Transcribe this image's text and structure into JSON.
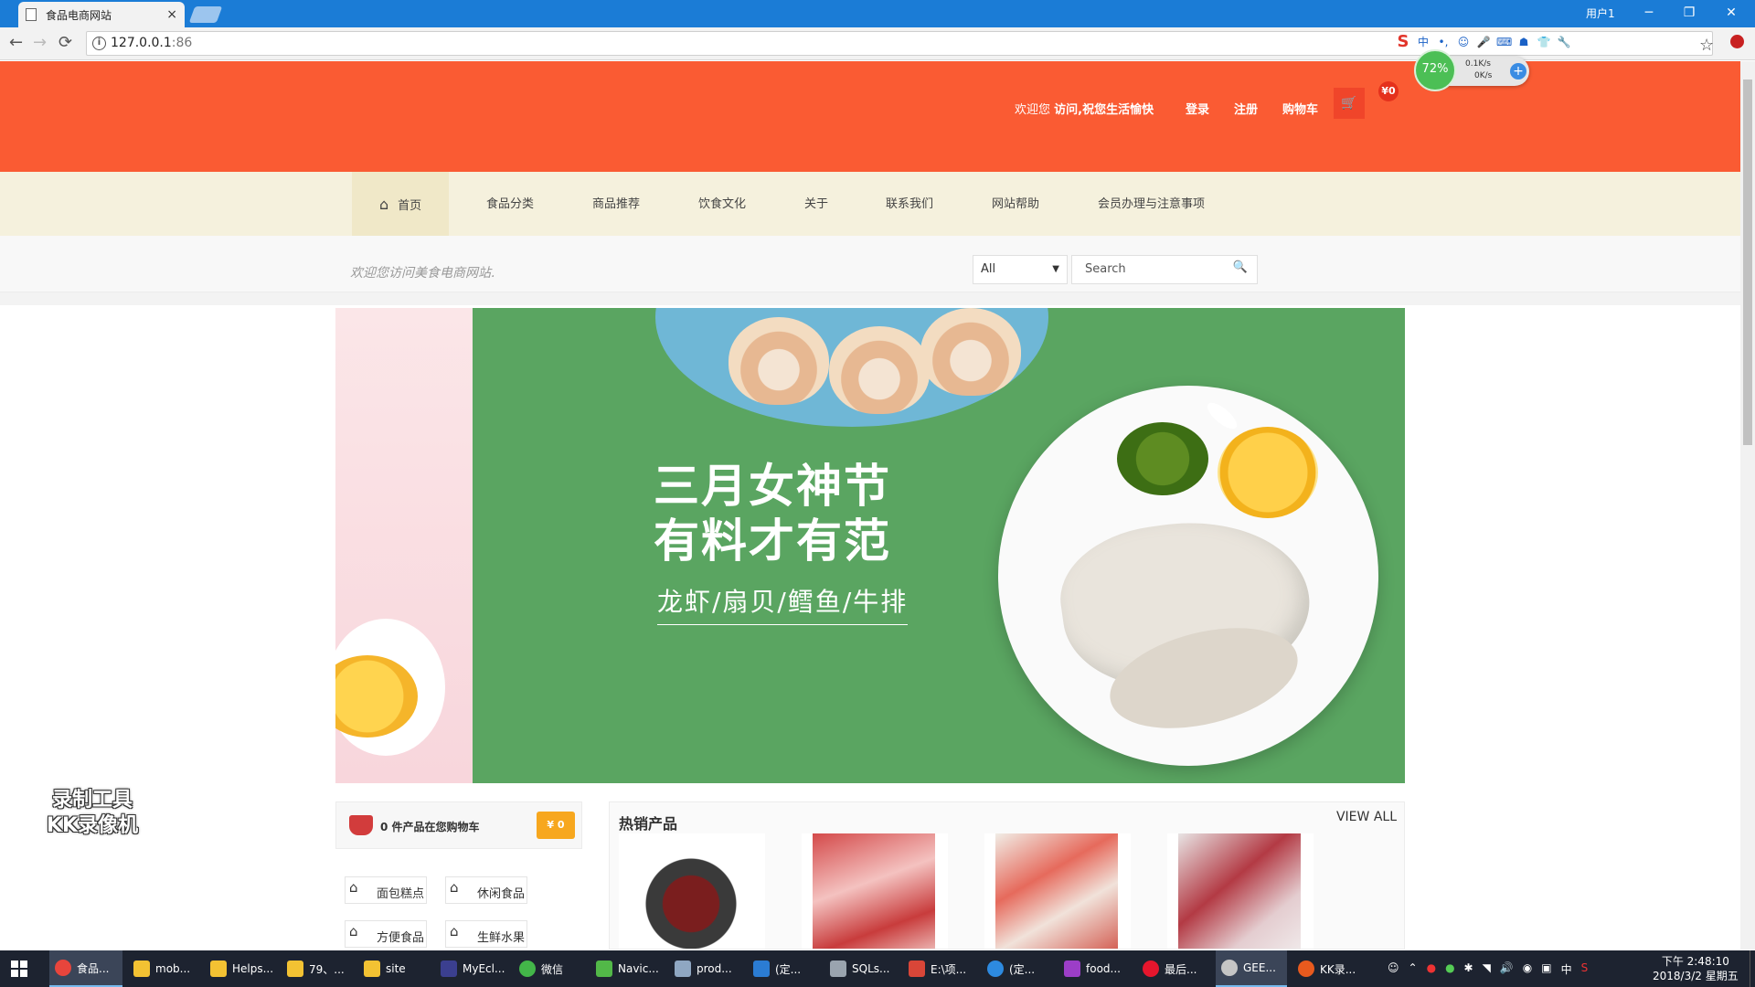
{
  "browser": {
    "tab_title": "食品电商网站",
    "tab_close": "×",
    "url_host": "127.0.0.1",
    "url_port": ":86",
    "window_user": "用户1",
    "win_min": "─",
    "win_restore": "❐",
    "win_close": "✕",
    "back": "←",
    "forward": "→",
    "reload": "⟳",
    "info": "i",
    "star": "☆",
    "extensions": [
      "中",
      "•,",
      "☺",
      "🎤",
      "⌨",
      "☗",
      "👕",
      "🔧"
    ],
    "ext_s": "S"
  },
  "net_widget": {
    "percent": "72%",
    "up": "0.1K/s",
    "down": "0K/s",
    "plus": "+"
  },
  "header": {
    "welcome_prefix": "欢迎您",
    "welcome_bold": "访问,祝您生活愉快",
    "login": "登录",
    "register": "注册",
    "cart": "购物车",
    "basket_icon": "🛒",
    "cart_total": "¥0"
  },
  "nav": {
    "home_icon": "⌂",
    "items": [
      "首页",
      "食品分类",
      "商品推荐",
      "饮食文化",
      "关于",
      "联系我们",
      "网站帮助",
      "会员办理与注意事项"
    ]
  },
  "search": {
    "tagline": "欢迎您访问美食电商网站.",
    "category": "All",
    "caret": "▼",
    "placeholder": "Search",
    "search_icon": "🔍"
  },
  "banner": {
    "title_line1": "三月女神节",
    "title_line2": "有料才有范",
    "subtitle": "龙虾/扇贝/鳕鱼/牛排"
  },
  "watermark": {
    "line1": "录制工具",
    "line2": "KK录像机"
  },
  "cartbox": {
    "text": "0 件产品在您购物车",
    "price": "¥ 0"
  },
  "categories": [
    {
      "icon": "⌂",
      "label": "面包糕点"
    },
    {
      "icon": "⌂",
      "label": "休闲食品"
    },
    {
      "icon": "⌂",
      "label": "方便食品"
    },
    {
      "icon": "⌂",
      "label": "生鲜水果"
    }
  ],
  "hot": {
    "title": "热销产品",
    "view_all": "VIEW ALL"
  },
  "taskbar": {
    "items": [
      "食品...",
      "mob...",
      "Helps...",
      "79、...",
      "site",
      "MyEcl...",
      "微信",
      "Navic...",
      "prod...",
      "(定...",
      "SQLs...",
      "E:\\项...",
      "(定...",
      "food...",
      "最后...",
      "GEE...",
      "KK录..."
    ],
    "tray": [
      "⌃",
      "●",
      "●",
      "✱",
      "◥",
      "🔊",
      "◉",
      "▣",
      "中",
      "S"
    ],
    "time": "下午 2:48:10",
    "date": "2018/3/2 星期五"
  },
  "colors": {
    "header_orange": "#fa5b33",
    "nav_cream": "#f5f1dd",
    "banner_green": "#5aa561",
    "taskbar": "#1d2330"
  }
}
